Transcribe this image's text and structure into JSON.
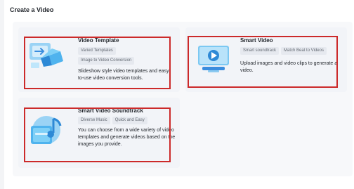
{
  "page": {
    "title": "Create a Video"
  },
  "cards": [
    {
      "title": "Video Template",
      "tags": [
        "Varied Templates",
        "Image to Video Conversion"
      ],
      "description": "Slideshow style video templates and easy-to-use video conversion tools.",
      "icon": "template-icon"
    },
    {
      "title": "Smart Video",
      "tags": [
        "Smart soundtrack",
        "Match Beat to Videos"
      ],
      "description": "Upload images and video clips to generate a video.",
      "icon": "play-screen-icon"
    },
    {
      "title": "Smart Video Soundtrack",
      "tags": [
        "Diverse Music",
        "Quick and Easy"
      ],
      "description": "You can choose from a wide variety of video templates and generate videos based on the images you provide.",
      "icon": "music-note-icon"
    }
  ],
  "colors": {
    "highlight": "#cc2a2a",
    "accent": "#3a8dde"
  }
}
